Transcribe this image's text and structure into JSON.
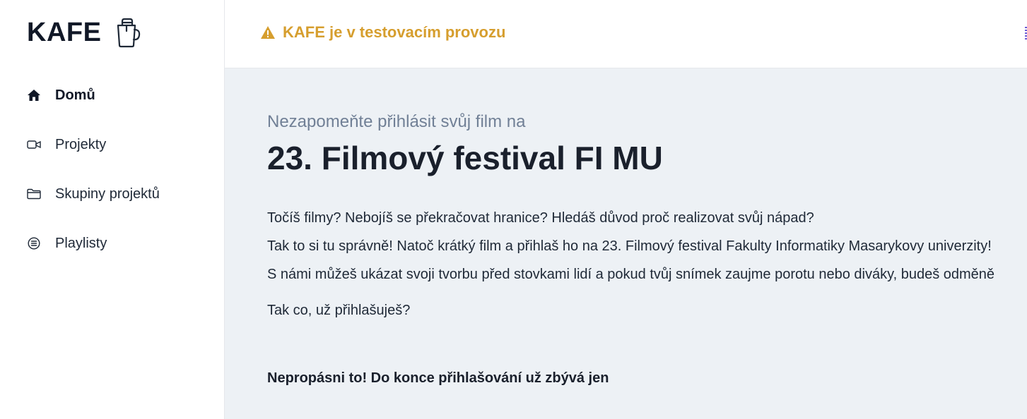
{
  "brand": {
    "name": "KAFE",
    "icon": "coffee-cup-icon"
  },
  "sidebar": {
    "items": [
      {
        "label": "Domů",
        "icon": "home-icon",
        "active": true
      },
      {
        "label": "Projekty",
        "icon": "video-camera-icon",
        "active": false
      },
      {
        "label": "Skupiny projektů",
        "icon": "folder-icon",
        "active": false
      },
      {
        "label": "Playlisty",
        "icon": "playlist-icon",
        "active": false
      }
    ]
  },
  "header": {
    "warning_icon": "warning-triangle-icon",
    "warning_text": "KAFE je v testovacím provozu",
    "warning_color": "#d69e2e"
  },
  "main": {
    "subtitle": "Nezapomeňte přihlásit svůj film na",
    "title": "23. Filmový festival FI MU",
    "paragraphs": [
      "Točíš filmy? Nebojíš se překračovat hranice? Hledáš důvod proč realizovat svůj nápad?",
      "Tak to si tu správně! Natoč krátký film a přihlaš ho na 23. Filmový festival Fakulty Informatiky Masarykovy univerzity!",
      "S námi můžeš ukázat svoji tvorbu před stovkami lidí a pokud tvůj snímek zaujme porotu nebo diváky, budeš odměně"
    ],
    "question": "Tak co, už přihlašuješ?",
    "countdown_label": "Nepropásni to! Do konce přihlašování už zbývá jen"
  }
}
